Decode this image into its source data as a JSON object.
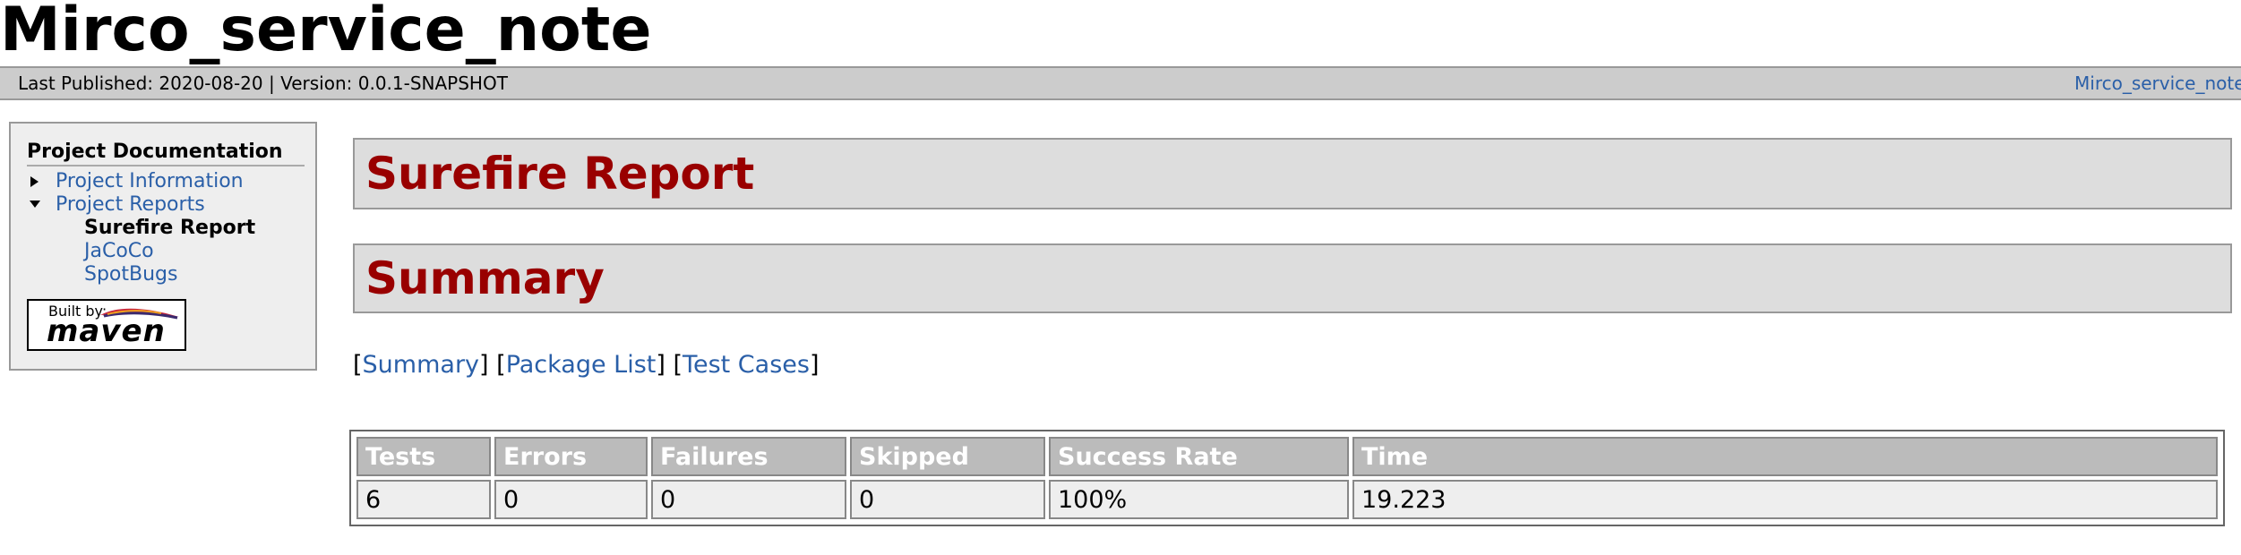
{
  "banner": {
    "title": "Mirco_service_note"
  },
  "breadcrumbs": {
    "published": "Last Published: 2020-08-20",
    "separator": " | ",
    "version": "Version: 0.0.1-SNAPSHOT",
    "project_link": "Mirco_service_note"
  },
  "nav": {
    "heading": "Project Documentation",
    "items": [
      {
        "label": "Project Information",
        "icon": "triangle-right-icon"
      },
      {
        "label": "Project Reports",
        "icon": "triangle-down-icon"
      }
    ],
    "subitems": [
      {
        "label": "Surefire Report",
        "current": true
      },
      {
        "label": "JaCoCo"
      },
      {
        "label": "SpotBugs"
      }
    ],
    "built_by": {
      "prefix": "Built by:",
      "name": "maven"
    }
  },
  "main": {
    "section_title": "Surefire Report",
    "summary_title": "Summary",
    "anchors": [
      "Summary",
      "Package List",
      "Test Cases"
    ],
    "table": {
      "headers": [
        "Tests",
        "Errors",
        "Failures",
        "Skipped",
        "Success Rate",
        "Time"
      ],
      "row": [
        "6",
        "0",
        "0",
        "0",
        "100%",
        "19.223"
      ]
    }
  },
  "colors": {
    "heading_red": "#990000",
    "link_blue": "#2a5fa8",
    "header_bg": "#bbbbbb",
    "cell_bg": "#eeeeee"
  }
}
